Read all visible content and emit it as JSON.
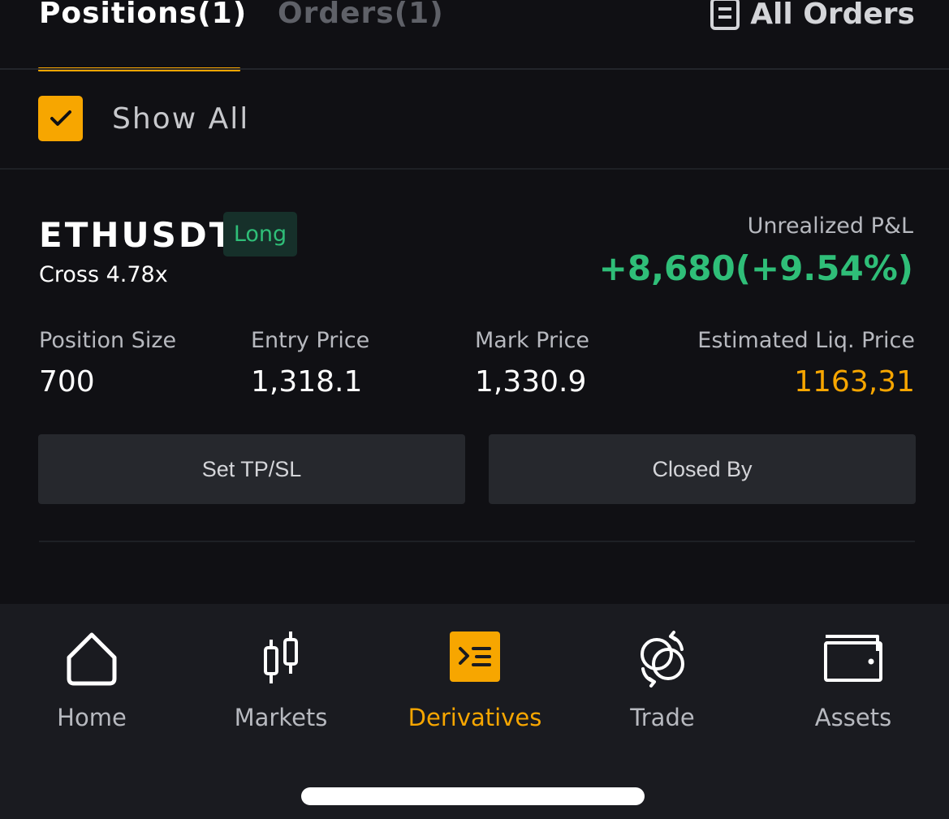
{
  "tabs": {
    "positions_label": "Positions(1)",
    "orders_label": "Orders(1)",
    "all_orders_label": "All Orders",
    "active": "positions",
    "accent_color": "#f7a600"
  },
  "filter": {
    "show_all_label": "Show All",
    "show_all_checked": true
  },
  "position": {
    "symbol": "ETHUSDT",
    "side": "Long",
    "margin_mode": "Cross 4.78x",
    "pnl_label": "Unrealized P&L",
    "pnl_value": "+8,680(+9.54%)",
    "pnl_color": "#2fbe78",
    "size_label": "Position Size",
    "size_value": "700",
    "entry_label": "Entry Price",
    "entry_value": "1,318.1",
    "mark_label": "Mark Price",
    "mark_value": "1,330.9",
    "liq_label": "Estimated Liq. Price",
    "liq_value": "1163,31",
    "liq_color": "#f7a600",
    "tpsl_button": "Set TP/SL",
    "closed_by_button": "Closed By"
  },
  "bottom_nav": {
    "items": [
      {
        "label": "Home",
        "icon": "home-icon",
        "active": false
      },
      {
        "label": "Markets",
        "icon": "candlestick-icon",
        "active": false
      },
      {
        "label": "Derivatives",
        "icon": "derivatives-icon",
        "active": true
      },
      {
        "label": "Trade",
        "icon": "trade-circles-icon",
        "active": false
      },
      {
        "label": "Assets",
        "icon": "wallet-icon",
        "active": false
      }
    ]
  }
}
